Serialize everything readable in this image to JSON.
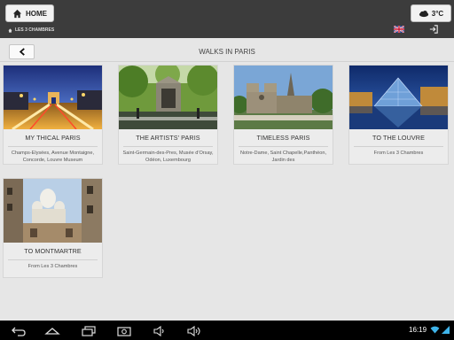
{
  "header": {
    "home_label": "HOME",
    "weather_label": "3°C",
    "breadcrumb": "LES 3 CHAMBRES"
  },
  "subheader": {
    "title": "WALKS IN PARIS"
  },
  "cards": [
    {
      "title": "MY THICAL PARIS",
      "description": "Champs-Elysées, Avenue Montaigne, Concorde, Louvre Museum"
    },
    {
      "title": "THE ARTISTS' PARIS",
      "description": "Saint-Germain-des-Pres, Musée d'Orsay, Odéon, Luxembourg"
    },
    {
      "title": "TIMELESS PARIS",
      "description": "Notre-Dame, Saint Chapelle,Panthéon, Jardin des"
    },
    {
      "title": "TO THE LOUVRE",
      "description": "From Les 3 Chambres"
    },
    {
      "title": "TO MONTMARTRE",
      "description": "From Les 3 Chambres"
    }
  ],
  "status_bar": {
    "time": "16:19"
  },
  "icons": {
    "home": "home-icon",
    "weather": "cloud-icon",
    "breadcrumb": "home-icon",
    "language": "uk-flag-icon",
    "login": "login-icon",
    "back": "chevron-left-icon"
  }
}
